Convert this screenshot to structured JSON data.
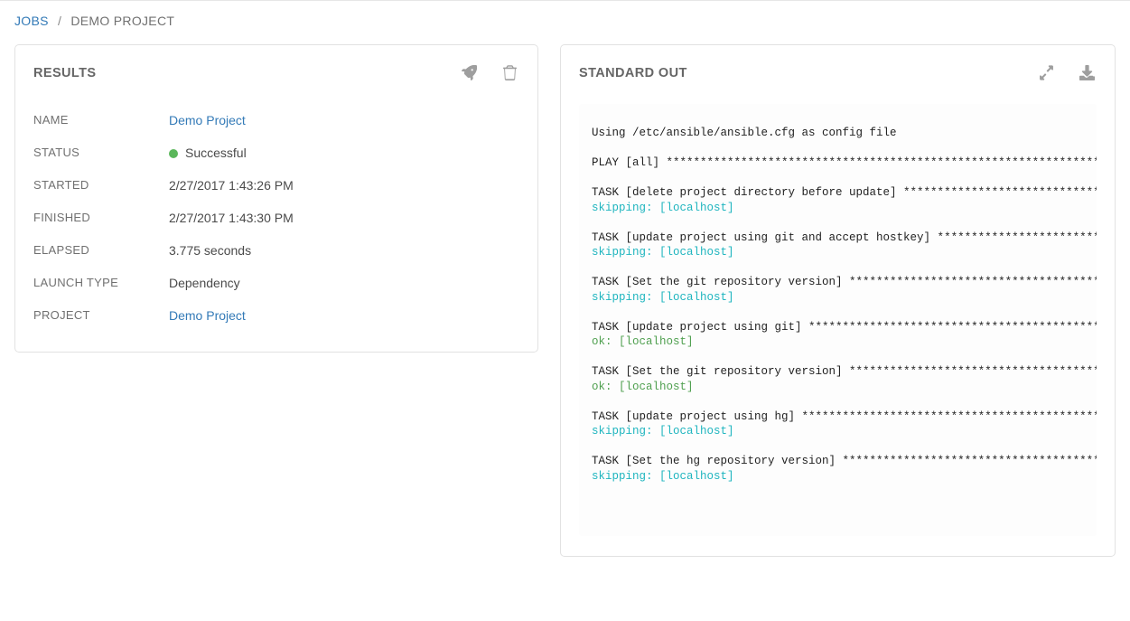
{
  "breadcrumb": {
    "root": "JOBS",
    "current": "DEMO PROJECT"
  },
  "results": {
    "title": "RESULTS",
    "labels": {
      "name": "NAME",
      "status": "STATUS",
      "started": "STARTED",
      "finished": "FINISHED",
      "elapsed": "ELAPSED",
      "launch_type": "LAUNCH TYPE",
      "project": "PROJECT"
    },
    "values": {
      "name": "Demo Project",
      "status_text": "Successful",
      "status_color": "#5bb75b",
      "started": "2/27/2017 1:43:26 PM",
      "finished": "2/27/2017 1:43:30 PM",
      "elapsed": "3.775 seconds",
      "launch_type": "Dependency",
      "project": "Demo Project"
    }
  },
  "stdout": {
    "title": "STANDARD OUT",
    "lines": [
      {
        "cls": "",
        "text": "Using /etc/ansible/ansible.cfg as config file"
      },
      {
        "cls": "",
        "text": ""
      },
      {
        "cls": "",
        "text": "PLAY [all] *********************************************************************"
      },
      {
        "cls": "",
        "text": ""
      },
      {
        "cls": "",
        "text": "TASK [delete project directory before update] *********************************"
      },
      {
        "cls": "sk",
        "text": "skipping: [localhost]"
      },
      {
        "cls": "",
        "text": ""
      },
      {
        "cls": "",
        "text": "TASK [update project using git and accept hostkey] ****************************"
      },
      {
        "cls": "sk",
        "text": "skipping: [localhost]"
      },
      {
        "cls": "",
        "text": ""
      },
      {
        "cls": "",
        "text": "TASK [Set the git repository version] *****************************************"
      },
      {
        "cls": "sk",
        "text": "skipping: [localhost]"
      },
      {
        "cls": "",
        "text": ""
      },
      {
        "cls": "",
        "text": "TASK [update project using git] ***********************************************"
      },
      {
        "cls": "ok",
        "text": "ok: [localhost]"
      },
      {
        "cls": "",
        "text": ""
      },
      {
        "cls": "",
        "text": "TASK [Set the git repository version] *****************************************"
      },
      {
        "cls": "ok",
        "text": "ok: [localhost]"
      },
      {
        "cls": "",
        "text": ""
      },
      {
        "cls": "",
        "text": "TASK [update project using hg] ************************************************"
      },
      {
        "cls": "sk",
        "text": "skipping: [localhost]"
      },
      {
        "cls": "",
        "text": ""
      },
      {
        "cls": "",
        "text": "TASK [Set the hg repository version] ******************************************"
      },
      {
        "cls": "sk",
        "text": "skipping: [localhost]"
      },
      {
        "cls": "",
        "text": ""
      }
    ]
  }
}
